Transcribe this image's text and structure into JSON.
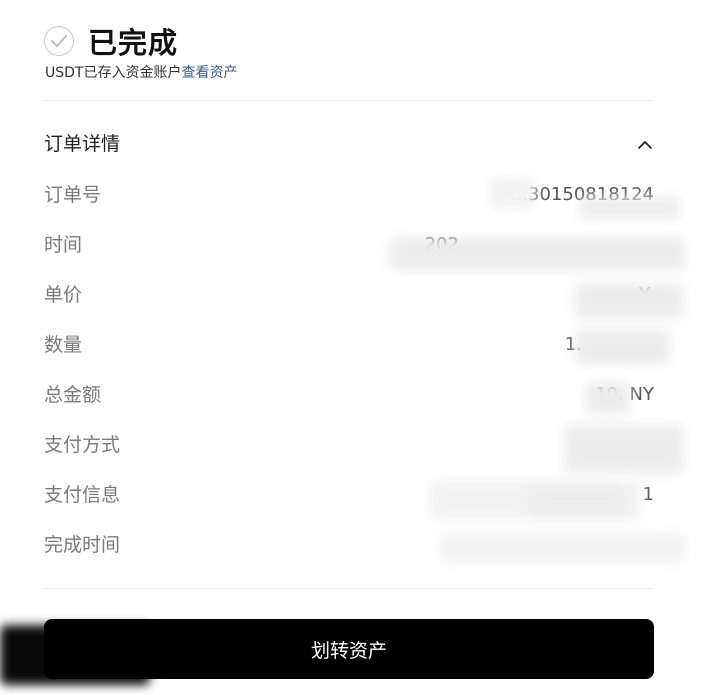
{
  "status": {
    "title": "已完成",
    "subtitle_prefix": "USDT已存入资金账户",
    "subtitle_link": "查看资产"
  },
  "order": {
    "section_title": "订单详情",
    "rows": [
      {
        "label": "订单号",
        "value": "...30150818124"
      },
      {
        "label": "时间",
        "value": "202"
      },
      {
        "label": "单价",
        "value": "Y"
      },
      {
        "label": "数量",
        "value": "1."
      },
      {
        "label": "总金额",
        "value": "10.     NY"
      },
      {
        "label": "支付方式",
        "value": ""
      },
      {
        "label": "支付信息",
        "value": "1"
      },
      {
        "label": "完成时间",
        "value": ""
      }
    ]
  },
  "action": {
    "transfer_label": "划转资产"
  },
  "icons": {
    "status": "check-circle-icon",
    "collapse": "chevron-up-icon"
  }
}
